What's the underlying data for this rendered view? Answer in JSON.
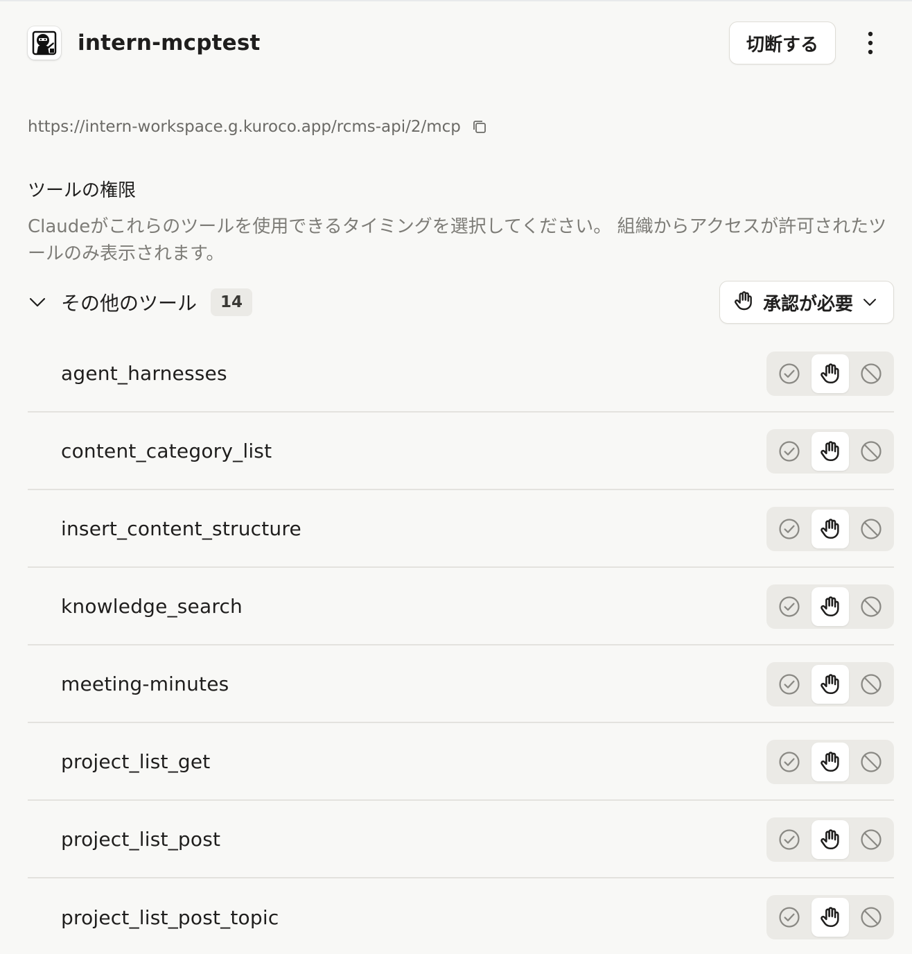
{
  "header": {
    "server_name": "intern-mcptest",
    "disconnect_label": "切断する",
    "logo_icon": "ninja-logo-icon",
    "menu_icon": "kebab-menu-icon"
  },
  "url": {
    "text": "https://intern-workspace.g.kuroco.app/rcms-api/2/mcp",
    "copy_icon": "copy-icon"
  },
  "permissions": {
    "title": "ツールの権限",
    "description": "Claudeがこれらのツールを使用できるタイミングを選択してください。 組織からアクセスが許可されたツールのみ表示されます。"
  },
  "group": {
    "label": "その他のツール",
    "count": "14",
    "expanded": true,
    "policy_label": "承認が必要",
    "policy_icon": "hand-icon"
  },
  "tools": [
    {
      "name": "agent_harnesses",
      "mode": "approval"
    },
    {
      "name": "content_category_list",
      "mode": "approval"
    },
    {
      "name": "insert_content_structure",
      "mode": "approval"
    },
    {
      "name": "knowledge_search",
      "mode": "approval"
    },
    {
      "name": "meeting-minutes",
      "mode": "approval"
    },
    {
      "name": "project_list_get",
      "mode": "approval"
    },
    {
      "name": "project_list_post",
      "mode": "approval"
    },
    {
      "name": "project_list_post_topic",
      "mode": "approval"
    }
  ],
  "colors": {
    "background": "#f8f8f6",
    "text": "#1f1e1d",
    "muted": "#7d7c77",
    "segment_bg": "#ebeae6"
  }
}
